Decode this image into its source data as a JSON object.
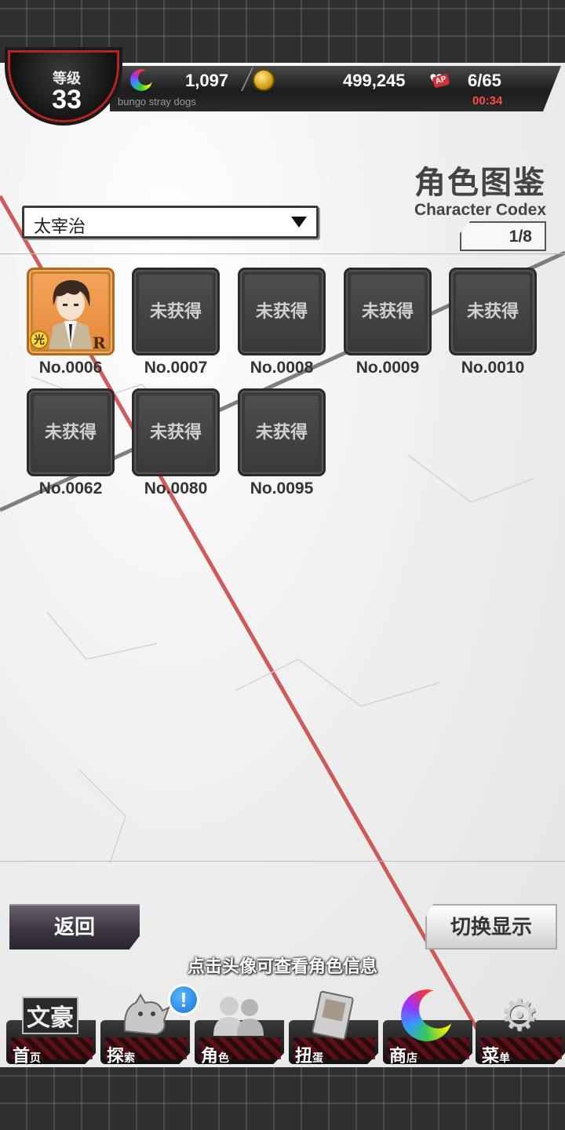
{
  "status": {
    "level_label": "等级",
    "level_value": "33",
    "gems": "1,097",
    "coins": "499,245",
    "ap": "6/65",
    "ap_tag": "AP",
    "timer": "00:34",
    "game_name": "bungo stray dogs"
  },
  "header": {
    "title": "角色图鉴",
    "subtitle": "Character Codex",
    "page": "1/8"
  },
  "filter": {
    "selected": "太宰治"
  },
  "grid": {
    "locked_text": "未获得",
    "items": [
      {
        "label": "No.0006",
        "owned": true,
        "rarity": "R",
        "attr": "光"
      },
      {
        "label": "No.0007",
        "owned": false
      },
      {
        "label": "No.0008",
        "owned": false
      },
      {
        "label": "No.0009",
        "owned": false
      },
      {
        "label": "No.0010",
        "owned": false
      },
      {
        "label": "No.0062",
        "owned": false
      },
      {
        "label": "No.0080",
        "owned": false
      },
      {
        "label": "No.0095",
        "owned": false
      }
    ]
  },
  "actions": {
    "back": "返回",
    "switch": "切换显示",
    "hint": "点击头像可查看角色信息"
  },
  "nav": {
    "items": [
      {
        "label": "首",
        "small": "页",
        "icon": "bungo-logo-icon",
        "emblem": "文豪"
      },
      {
        "label": "探",
        "small": "索",
        "icon": "explore-icon",
        "emblem": "🐱"
      },
      {
        "label": "角",
        "small": "色",
        "icon": "characters-icon",
        "emblem": "👥"
      },
      {
        "label": "扭",
        "small": "蛋",
        "icon": "gacha-icon",
        "emblem": "📖"
      },
      {
        "label": "商",
        "small": "店",
        "icon": "shop-icon",
        "emblem": "🌙"
      },
      {
        "label": "菜",
        "small": "单",
        "icon": "menu-gear-icon",
        "emblem": "⚙"
      }
    ],
    "notification": "!"
  },
  "colors": {
    "accent_red": "#c23a3a",
    "timer_red": "#ff4a4a",
    "notif_blue": "#1675d6"
  }
}
